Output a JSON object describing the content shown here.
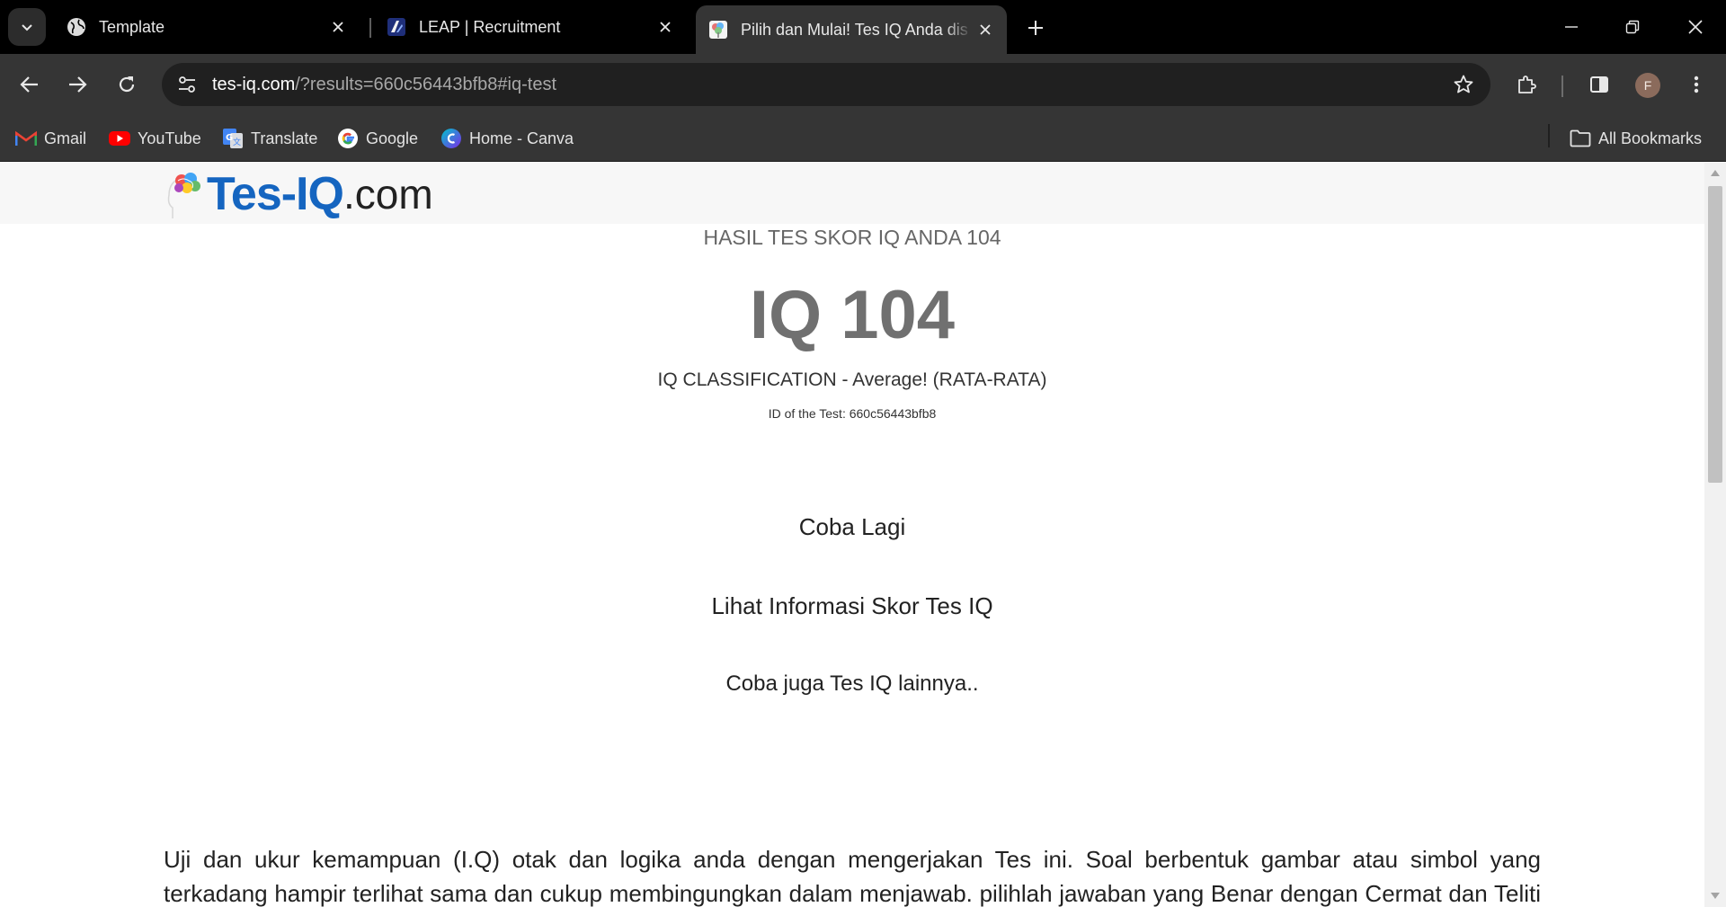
{
  "browser": {
    "tabs": [
      {
        "title": "Template",
        "icon": "globe-icon",
        "active": false
      },
      {
        "title": "LEAP | Recruitment",
        "icon": "leap-favicon",
        "active": false
      },
      {
        "title": "Pilih dan Mulai! Tes IQ Anda dis",
        "icon": "tes-iq-favicon",
        "active": true
      }
    ],
    "url": {
      "host": "tes-iq.com",
      "rest": "/?results=660c56443bfb8#iq-test"
    },
    "profile_initial": "F",
    "bookmarks": [
      {
        "label": "Gmail",
        "icon": "gmail-icon"
      },
      {
        "label": "YouTube",
        "icon": "youtube-icon"
      },
      {
        "label": "Translate",
        "icon": "translate-icon"
      },
      {
        "label": "Google",
        "icon": "google-icon"
      },
      {
        "label": "Home - Canva",
        "icon": "canva-icon"
      }
    ],
    "all_bookmarks": "All Bookmarks"
  },
  "site": {
    "logo": {
      "main": "Tes-IQ",
      "suffix": ".com"
    }
  },
  "result": {
    "heading": "HASIL TES SKOR IQ ANDA 104",
    "score": "IQ 104",
    "classification": "IQ CLASSIFICATION - Average! (RATA-RATA)",
    "test_id": "ID of the Test: 660c56443bfb8",
    "links": {
      "retry": "Coba Lagi",
      "info": "Lihat Informasi Skor Tes IQ",
      "other": "Coba juga Tes IQ lainnya.."
    }
  },
  "content": {
    "paragraph": "Uji dan ukur kemampuan (I.Q) otak dan logika anda dengan mengerjakan Tes ini. Soal berbentuk gambar atau simbol yang terkadang hampir terlihat sama dan cukup membingungkan dalam menjawab. pilihlah jawaban yang Benar dengan Cermat dan Teliti dengan cara"
  },
  "colors": {
    "brand_blue": "#1565c0",
    "score_gray": "#707070"
  }
}
